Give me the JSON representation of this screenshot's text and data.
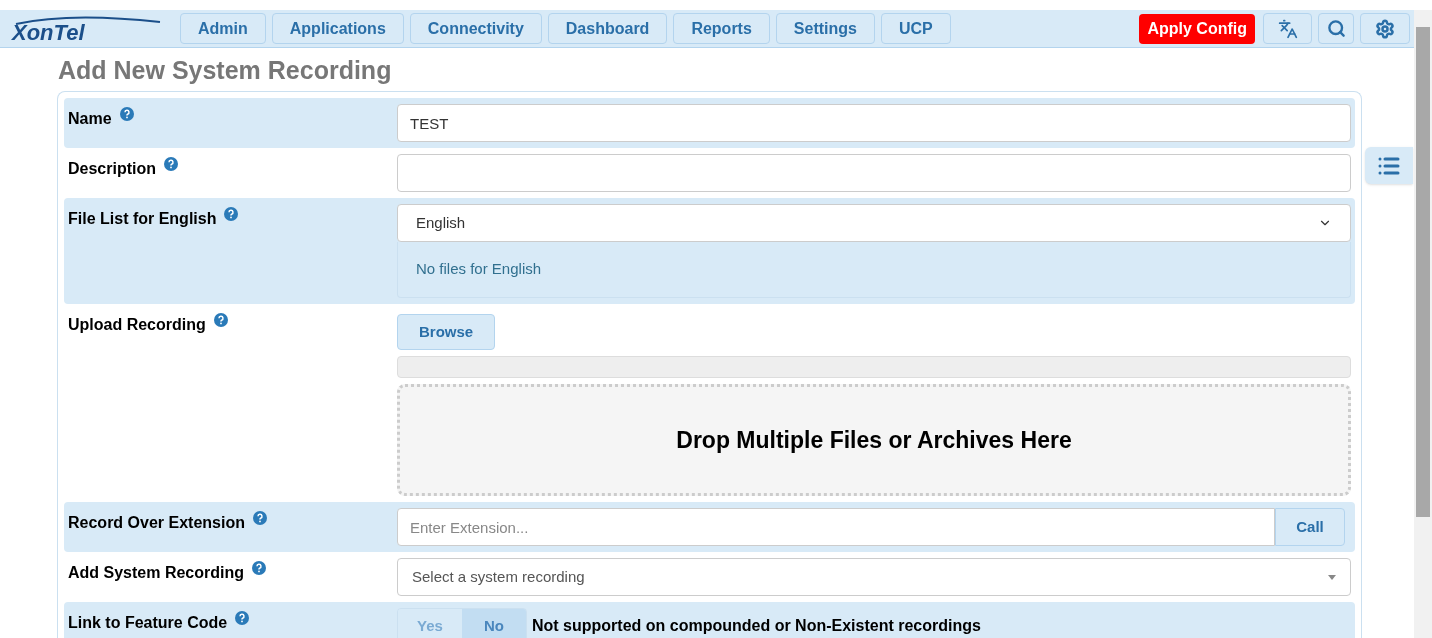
{
  "logo": "XonTel",
  "nav": [
    {
      "label": "Admin"
    },
    {
      "label": "Applications"
    },
    {
      "label": "Connectivity"
    },
    {
      "label": "Dashboard"
    },
    {
      "label": "Reports"
    },
    {
      "label": "Settings"
    },
    {
      "label": "UCP"
    }
  ],
  "apply_button": "Apply Config",
  "title": "Add New System Recording",
  "rows": [
    {
      "kind": "text",
      "label": "Name",
      "value": "TEST"
    },
    {
      "kind": "text",
      "label": "Description",
      "value": ""
    },
    {
      "kind": "filelist",
      "label": "File List for English",
      "value": "English",
      "note": "No files for English"
    },
    {
      "kind": "upload",
      "label": "Upload Recording",
      "button": "Browse",
      "level": 0,
      "drop_text": "Drop Multiple Files or Archives Here"
    },
    {
      "kind": "call",
      "label": "Record Over Extension",
      "placeholder": "Enter Extension...",
      "button": "Call"
    },
    {
      "kind": "select",
      "label": "Add System Recording",
      "placeholder": "Select a system recording"
    },
    {
      "kind": "toggle",
      "label": "Link to Feature Code",
      "options": [
        {
          "label": "Yes",
          "selected": false
        },
        {
          "label": "No",
          "selected": true
        }
      ],
      "note": "Not supported on compounded or Non-Existent recordings"
    }
  ]
}
